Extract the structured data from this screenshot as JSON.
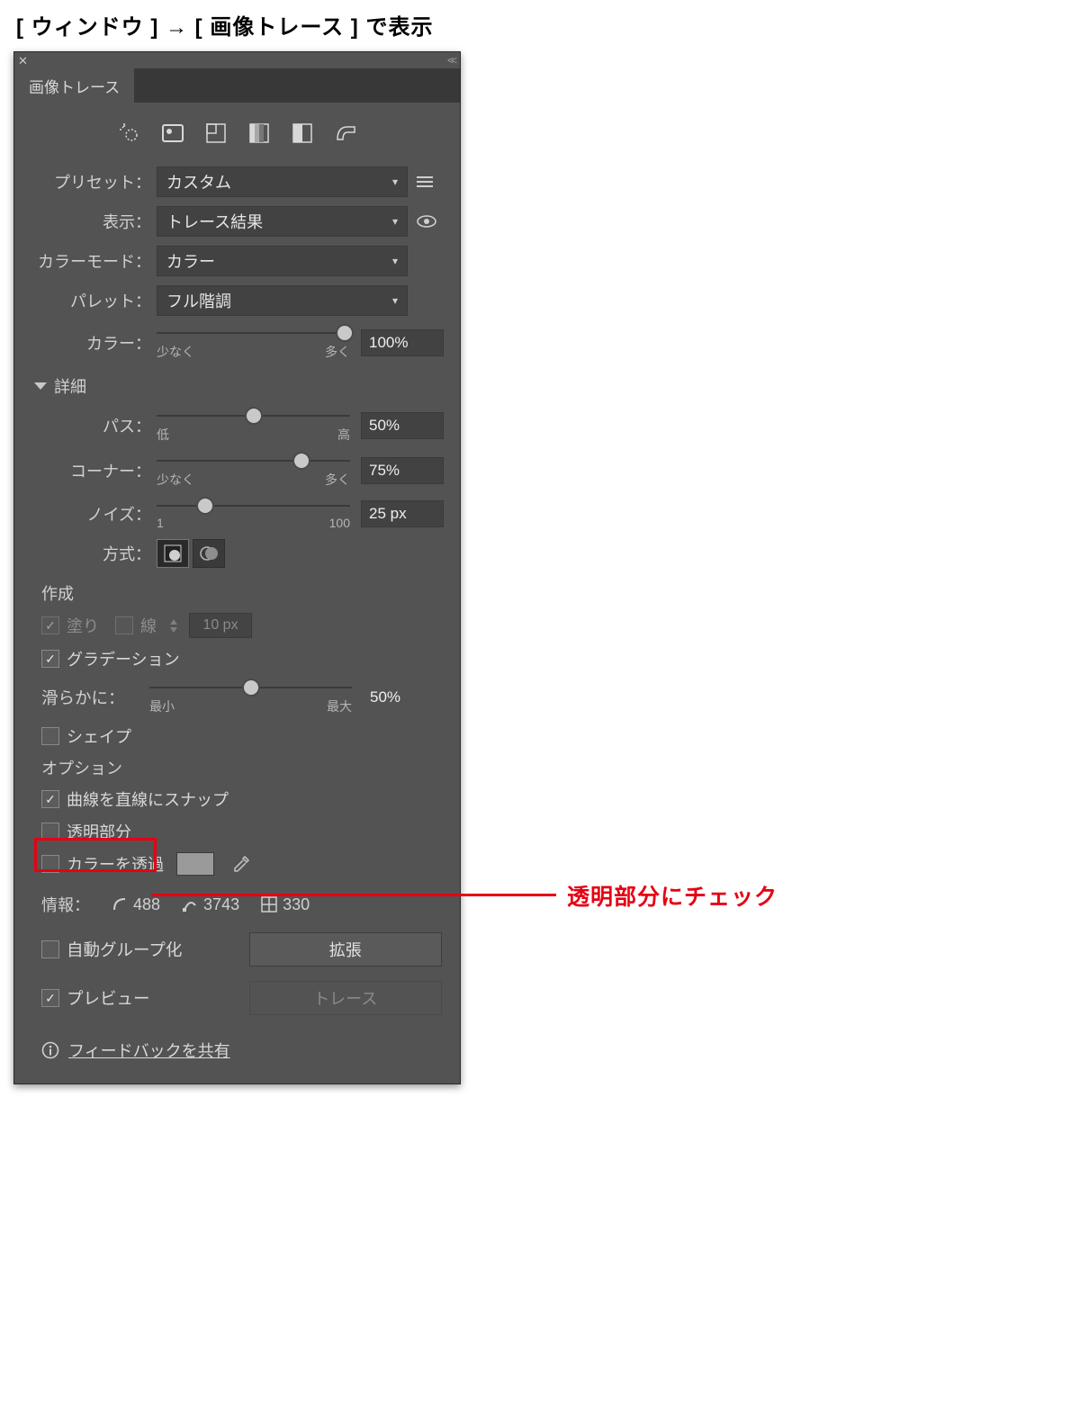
{
  "page_title": "[ ウィンドウ ]  →  [ 画像トレース ] で表示",
  "panel": {
    "tab": "画像トレース",
    "preset": {
      "label": "プリセット：",
      "value": "カスタム"
    },
    "view": {
      "label": "表示：",
      "value": "トレース結果"
    },
    "colormode": {
      "label": "カラーモード：",
      "value": "カラー"
    },
    "palette": {
      "label": "パレット：",
      "value": "フル階調"
    },
    "color_slider": {
      "label": "カラー：",
      "min": "少なく",
      "max": "多く",
      "value": "100%"
    },
    "advanced": "詳細",
    "path": {
      "label": "パス：",
      "min": "低",
      "max": "高",
      "value": "50%"
    },
    "corner": {
      "label": "コーナー：",
      "min": "少なく",
      "max": "多く",
      "value": "75%"
    },
    "noise": {
      "label": "ノイズ：",
      "min": "1",
      "max": "100",
      "value": "25 px"
    },
    "method": {
      "label": "方式："
    },
    "create": "作成",
    "fill": "塗り",
    "stroke": "線",
    "stroke_width": "10 px",
    "gradient": "グラデーション",
    "smooth": {
      "label": "滑らかに：",
      "min": "最小",
      "max": "最大",
      "value": "50%"
    },
    "shape": "シェイプ",
    "options": "オプション",
    "snap": "曲線を直線にスナップ",
    "transparent": "透明部分",
    "transparent_color": "カラーを透過",
    "info": {
      "label": "情報：",
      "paths": "488",
      "anchors": "3743",
      "colors": "330"
    },
    "autogroup": "自動グループ化",
    "expand": "拡張",
    "preview": "プレビュー",
    "trace": "トレース",
    "feedback": "フィードバックを共有"
  },
  "callout": "透明部分にチェック"
}
